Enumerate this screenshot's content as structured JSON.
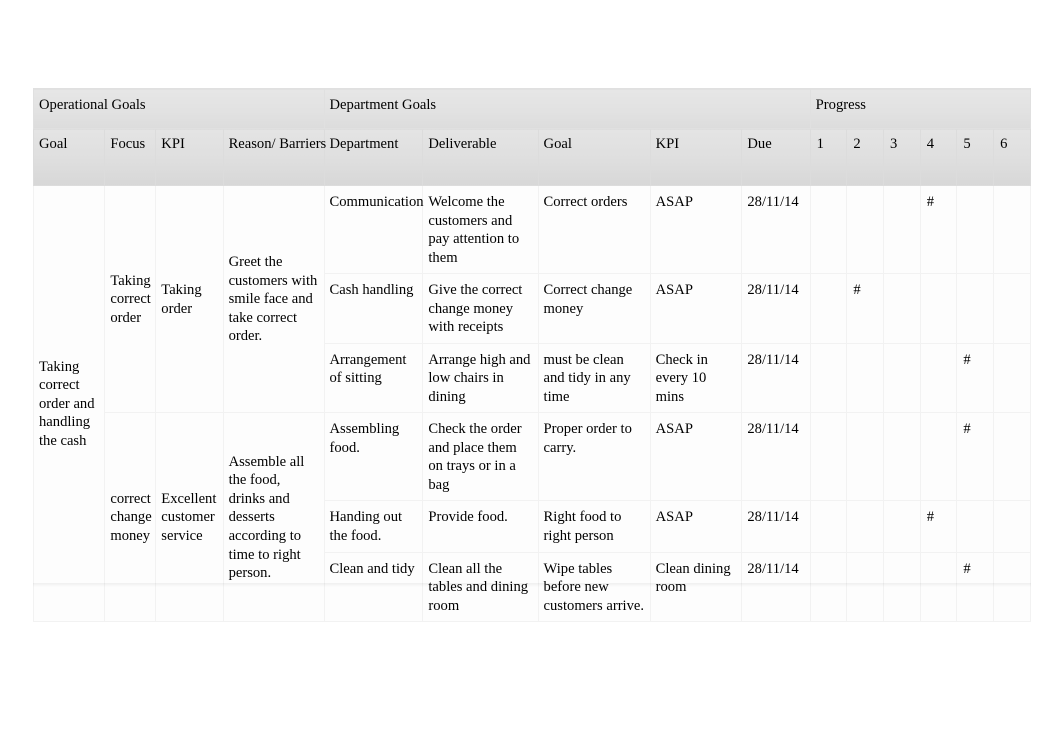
{
  "table": {
    "banner": {
      "operational_goals": "Operational Goals",
      "department_goals": "Department Goals",
      "progress": "Progress"
    },
    "columns": {
      "goal": "Goal",
      "focus": "Focus",
      "kpi": "KPI",
      "reason_barriers": "Reason/ Barriers",
      "department": "Department",
      "deliverable": "Deliverable",
      "dept_goal": "Goal",
      "dept_kpi": "KPI",
      "due": "Due",
      "p1": "1",
      "p2": "2",
      "p3": "3",
      "p4": "4",
      "p5": "5",
      "p6": "6"
    },
    "operational": {
      "goal": "Taking correct order and handling the cash",
      "groups": [
        {
          "focus": "Taking correct order",
          "kpi": "Taking order",
          "reason": " Greet the customers with smile face and take correct order."
        },
        {
          "focus": "correct change money",
          "kpi": "Excellent customer service",
          "reason": "Assemble all the food, drinks and desserts according to time to right person."
        }
      ]
    },
    "rows": [
      {
        "department": "Communication",
        "deliverable": "Welcome the customers and pay attention to them",
        "goal": "Correct orders",
        "kpi": "ASAP",
        "due": "28/11/14",
        "progress": [
          "",
          "",
          "",
          "#",
          "",
          ""
        ]
      },
      {
        "department": "Cash handling",
        "deliverable": "Give the correct change money with receipts",
        "goal": "Correct change money",
        "kpi": "ASAP",
        "due": "28/11/14",
        "progress": [
          "",
          "#",
          "",
          "",
          "",
          ""
        ]
      },
      {
        "department": "Arrangement of sitting",
        "deliverable": "Arrange high and low chairs in dining",
        "goal": "must be clean and tidy in any time",
        "kpi": "Check in every 10 mins",
        "due": "28/11/14",
        "progress": [
          "",
          "",
          "",
          "",
          "#",
          ""
        ]
      },
      {
        "department": "Assembling food.",
        "deliverable": "Check the order and place them on trays or in a bag",
        "goal": "Proper order to carry.",
        "kpi": "ASAP",
        "due": "28/11/14",
        "progress": [
          "",
          "",
          "",
          "",
          "#",
          ""
        ]
      },
      {
        "department": "Handing out the food.",
        "deliverable": "Provide food.",
        "goal": "Right food to right person",
        "kpi": "ASAP",
        "due": "28/11/14",
        "progress": [
          "",
          "",
          "",
          "#",
          "",
          ""
        ]
      },
      {
        "department": "Clean and tidy",
        "deliverable": "Clean all the tables and dining room",
        "goal": "Wipe tables before new customers arrive.",
        "kpi": "Clean dining room",
        "due": "28/11/14",
        "progress": [
          "",
          "",
          "",
          "",
          "#",
          ""
        ]
      }
    ]
  }
}
